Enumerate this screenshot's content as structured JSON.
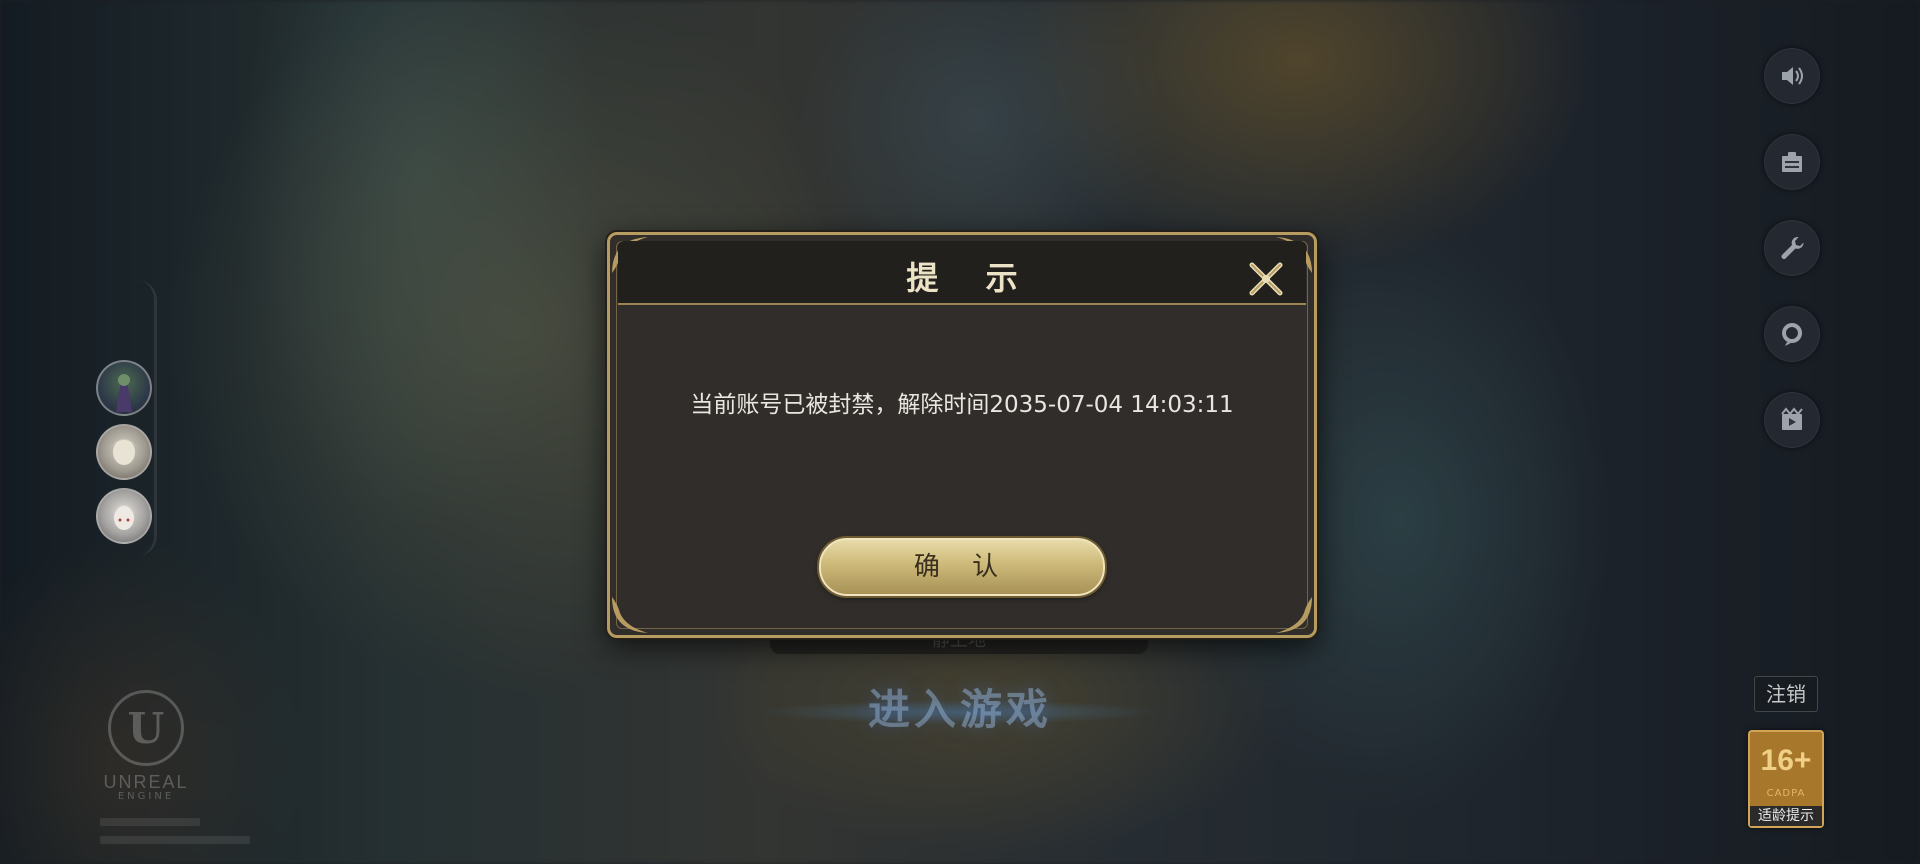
{
  "dialog": {
    "title": "提 示",
    "message": "当前账号已被封禁，解除时间2035-07-04 14:03:11",
    "confirm_label": "确 认",
    "close_icon": "close-icon"
  },
  "background": {
    "enter_game_label": "进入游戏",
    "under_panel_text": "静上地"
  },
  "sidebar_right": {
    "icons": [
      "speaker-icon",
      "notice-board-icon",
      "wrench-icon",
      "customer-service-icon",
      "video-icon"
    ]
  },
  "account": {
    "logout_label": "注销"
  },
  "age_rating": {
    "rating": "16+",
    "org": "CADPA",
    "hint": "适龄提示"
  },
  "engine_logo": {
    "name": "UNREAL",
    "sub": "ENGINE"
  },
  "colors": {
    "dialog_border": "#b79c62",
    "dialog_bg": "#302d2a",
    "button_gold": "#cdb979",
    "age_badge": "#a7772b"
  }
}
